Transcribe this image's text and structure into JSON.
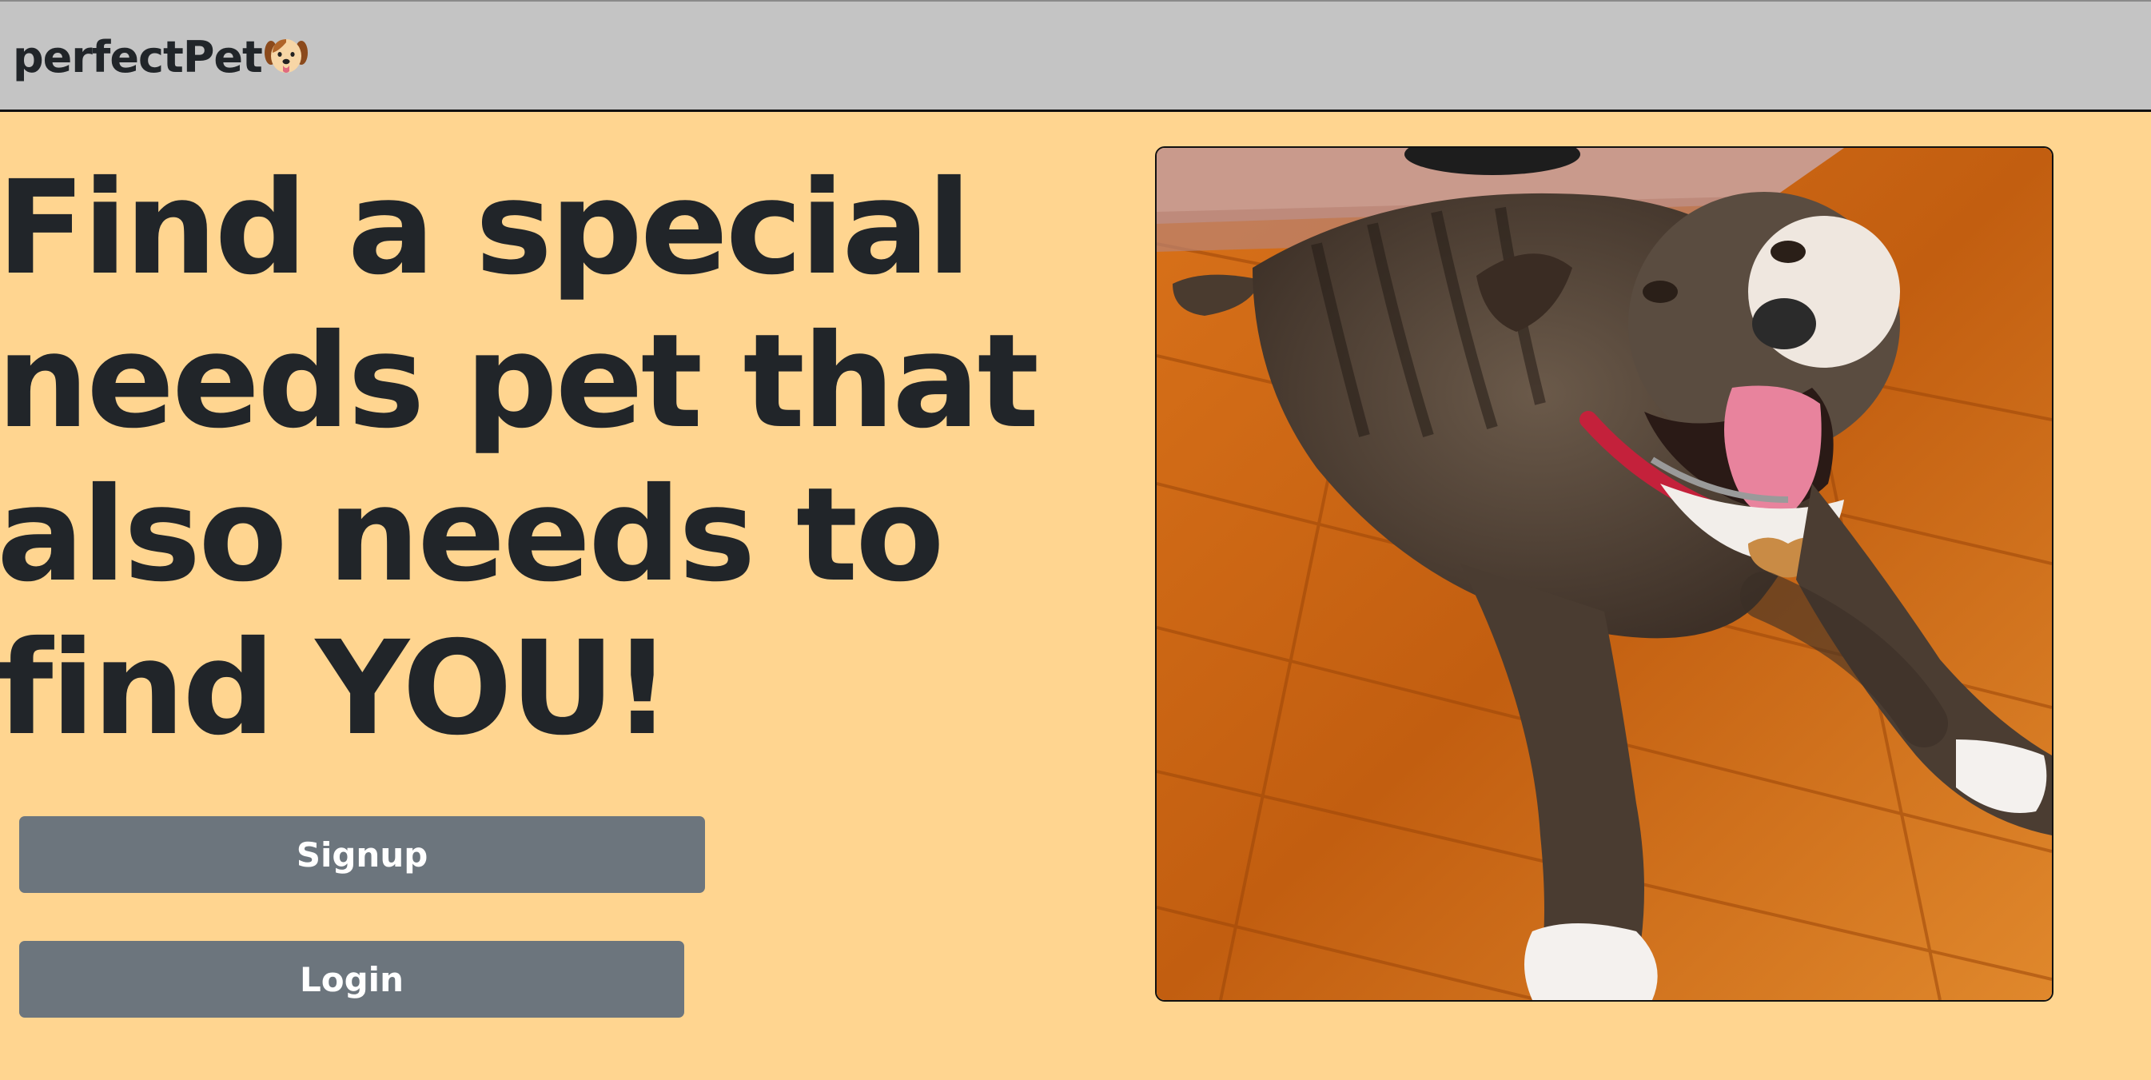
{
  "navbar": {
    "brand_text": "perfectPet",
    "brand_icon": "dog-face-icon"
  },
  "hero": {
    "headline": "Find a special needs pet that also needs to find YOU!",
    "photo_subject": "dog-photo"
  },
  "buttons": {
    "signup_label": "Signup",
    "login_label": "Login"
  },
  "colors": {
    "background": "#ffd590",
    "navbar": "#c4c4c4",
    "button": "#6c757d",
    "text": "#212529"
  }
}
